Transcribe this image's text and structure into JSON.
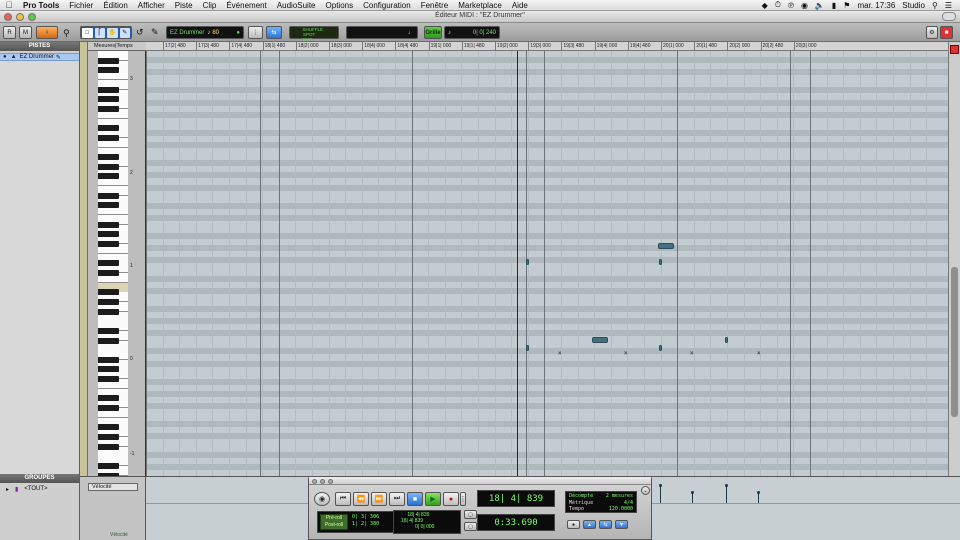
{
  "menubar": {
    "app": "Pro Tools",
    "items": [
      "Fichier",
      "Édition",
      "Afficher",
      "Piste",
      "Clip",
      "Événement",
      "AudioSuite",
      "Options",
      "Configuration",
      "Fenêtre",
      "Marketplace",
      "Aide"
    ],
    "clock": "mar. 17:36",
    "user": "Studio"
  },
  "window": {
    "title": "Éditeur MIDI : \"EZ Drummer\""
  },
  "toolbar": {
    "track_selector": "EZ Drummer",
    "note_value": "80",
    "shuffle_label": "SHUFFLE",
    "spot_label": "SPOT",
    "slip_label": "SLIP",
    "grid_mode_label": "GRID",
    "grid_label": "Grille",
    "grid_value": "0| 0| 240"
  },
  "tracks_panel": {
    "title": "PISTES",
    "tracks": [
      {
        "name": "EZ Drummer"
      }
    ]
  },
  "groups_panel": {
    "title": "GROUPES",
    "groups": [
      {
        "name": "<TOUT>"
      }
    ]
  },
  "ruler": {
    "label": "Mesures|Temps",
    "ticks": [
      "17|2| 480",
      "17|3| 480",
      "17|4| 480",
      "18|1| 480",
      "18|2| 000",
      "18|3| 000",
      "18|4| 000",
      "18|4| 480",
      "19|1| 000",
      "19|1| 480",
      "19|2| 000",
      "19|3| 000",
      "19|3| 480",
      "19|4| 000",
      "19|4| 480",
      "20|1| 000",
      "20|1| 480",
      "20|2| 000",
      "20|2| 480",
      "20|3| 000"
    ]
  },
  "keyboard": {
    "octave_labels": [
      "3",
      "2",
      "1",
      "0",
      "-1"
    ]
  },
  "velocity_lane": {
    "selector": "Vélocité",
    "label": "Vélocité"
  },
  "transport": {
    "counter_main": "18| 4| 839",
    "counter_sub": "0:33.690",
    "preroll_label": "Pré-roll",
    "postroll_label": "Post-roll",
    "preroll_value": "0| 3| 306",
    "postroll_value": "1| 2| 380",
    "start_label": "Début",
    "end_label": "Fin",
    "length_label": "Longueur",
    "start_value": "18| 4| 839",
    "end_value": "18| 4| 839",
    "length_value": "0| 0| 000",
    "countoff_label": "Décompte",
    "countoff_value": "2 mesures",
    "meter_label": "Métrique",
    "meter_value": "4/4",
    "tempo_label": "Tempo",
    "tempo_value": "120.0000"
  }
}
